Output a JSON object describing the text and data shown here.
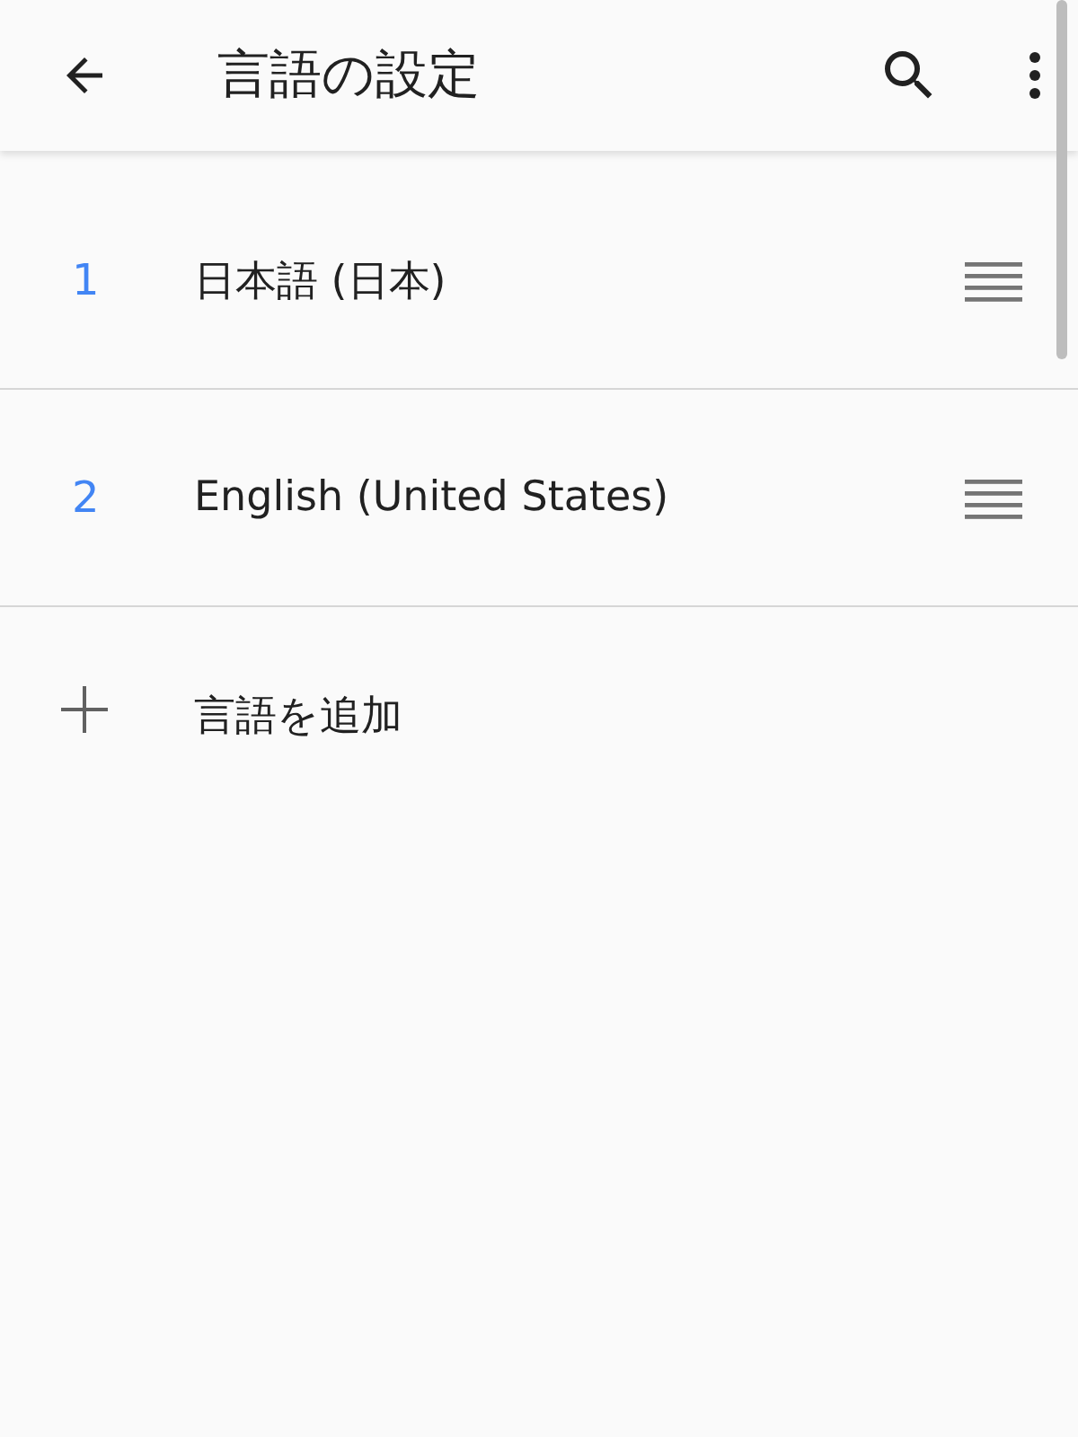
{
  "app_bar": {
    "title": "言語の設定"
  },
  "languages": [
    {
      "number": "1",
      "name": "日本語 (日本)"
    },
    {
      "number": "2",
      "name": "English (United States)"
    }
  ],
  "add_language": {
    "label": "言語を追加"
  }
}
